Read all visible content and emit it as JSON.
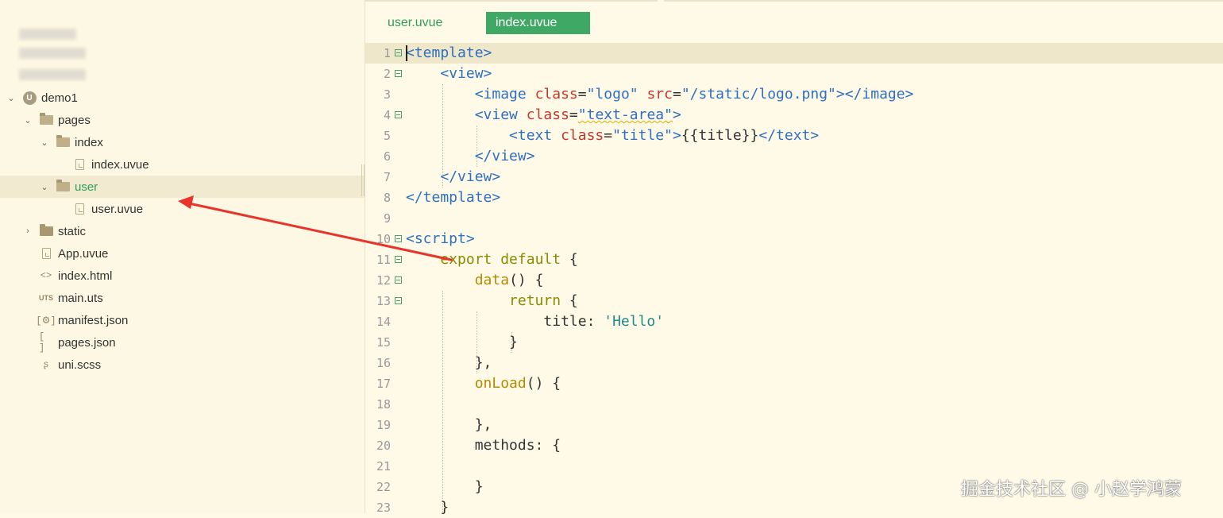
{
  "tabs": [
    {
      "label": "user.uvue",
      "active": false
    },
    {
      "label": "index.uvue",
      "active": true
    }
  ],
  "sidebar": {
    "tree": [
      {
        "label": "demo1",
        "icon": "uni-app-logo-icon",
        "expanded": true
      },
      {
        "label": "pages",
        "icon": "folder-open-icon",
        "expanded": true
      },
      {
        "label": "index",
        "icon": "folder-open-icon",
        "expanded": true
      },
      {
        "label": "index.uvue",
        "icon": "file-icon"
      },
      {
        "label": "user",
        "icon": "folder-open-icon",
        "expanded": true,
        "selected": true
      },
      {
        "label": "user.uvue",
        "icon": "file-icon"
      },
      {
        "label": "static",
        "icon": "folder-icon",
        "expanded": false
      },
      {
        "label": "App.uvue",
        "icon": "file-icon"
      },
      {
        "label": "index.html",
        "icon": "html-icon",
        "glyph": "<>"
      },
      {
        "label": "main.uts",
        "icon": "uts-icon",
        "glyph": "UTS"
      },
      {
        "label": "manifest.json",
        "icon": "gear-file-icon",
        "glyph": "[⚙]"
      },
      {
        "label": "pages.json",
        "icon": "json-icon",
        "glyph": "[ ]"
      },
      {
        "label": "uni.scss",
        "icon": "sass-icon",
        "glyph": "ʂ"
      }
    ]
  },
  "editor": {
    "lines": [
      {
        "n": "1",
        "fold": true,
        "tokens": [
          [
            "t-tag",
            "<template>"
          ]
        ]
      },
      {
        "n": "2",
        "fold": true,
        "tokens": [
          [
            "t-plain",
            "    "
          ],
          [
            "t-tag",
            "<view>"
          ]
        ]
      },
      {
        "n": "3",
        "fold": false,
        "tokens": [
          [
            "t-plain",
            "        "
          ],
          [
            "t-tag",
            "<image "
          ],
          [
            "t-attr",
            "class"
          ],
          [
            "t-plain",
            "="
          ],
          [
            "t-str",
            "\"logo\""
          ],
          [
            "t-plain",
            " "
          ],
          [
            "t-attr",
            "src"
          ],
          [
            "t-plain",
            "="
          ],
          [
            "t-str",
            "\"/static/logo.png\""
          ],
          [
            "t-tag",
            "></image>"
          ]
        ]
      },
      {
        "n": "4",
        "fold": true,
        "tokens": [
          [
            "t-plain",
            "        "
          ],
          [
            "t-tag",
            "<view "
          ],
          [
            "t-attr",
            "class"
          ],
          [
            "t-plain",
            "="
          ],
          [
            "t-str",
            "\"text-area\""
          ],
          [
            "t-tag",
            ">"
          ]
        ]
      },
      {
        "n": "5",
        "fold": false,
        "tokens": [
          [
            "t-plain",
            "            "
          ],
          [
            "t-tag",
            "<text "
          ],
          [
            "t-attr",
            "class"
          ],
          [
            "t-plain",
            "="
          ],
          [
            "t-str",
            "\"title\""
          ],
          [
            "t-tag",
            ">"
          ],
          [
            "t-plain",
            "{{title}}"
          ],
          [
            "t-tag",
            "</text>"
          ]
        ]
      },
      {
        "n": "6",
        "fold": false,
        "tokens": [
          [
            "t-plain",
            "        "
          ],
          [
            "t-tag",
            "</view>"
          ]
        ]
      },
      {
        "n": "7",
        "fold": false,
        "tokens": [
          [
            "t-plain",
            "    "
          ],
          [
            "t-tag",
            "</view>"
          ]
        ]
      },
      {
        "n": "8",
        "fold": false,
        "tokens": [
          [
            "t-tag",
            "</template>"
          ]
        ]
      },
      {
        "n": "9",
        "fold": false,
        "tokens": []
      },
      {
        "n": "10",
        "fold": true,
        "tokens": [
          [
            "t-tag",
            "<script>"
          ]
        ]
      },
      {
        "n": "11",
        "fold": true,
        "tokens": [
          [
            "t-plain",
            "    "
          ],
          [
            "t-kw",
            "export default"
          ],
          [
            "t-plain",
            " {"
          ]
        ]
      },
      {
        "n": "12",
        "fold": true,
        "tokens": [
          [
            "t-plain",
            "        "
          ],
          [
            "t-fn",
            "data"
          ],
          [
            "t-plain",
            "() {"
          ]
        ]
      },
      {
        "n": "13",
        "fold": true,
        "tokens": [
          [
            "t-plain",
            "            "
          ],
          [
            "t-kw",
            "return"
          ],
          [
            "t-plain",
            " {"
          ]
        ]
      },
      {
        "n": "14",
        "fold": false,
        "tokens": [
          [
            "t-plain",
            "                title: "
          ],
          [
            "t-sstr",
            "'Hello'"
          ]
        ]
      },
      {
        "n": "15",
        "fold": false,
        "tokens": [
          [
            "t-plain",
            "            }"
          ]
        ]
      },
      {
        "n": "16",
        "fold": false,
        "tokens": [
          [
            "t-plain",
            "        },"
          ]
        ]
      },
      {
        "n": "17",
        "fold": false,
        "tokens": [
          [
            "t-plain",
            "        "
          ],
          [
            "t-fn",
            "onLoad"
          ],
          [
            "t-plain",
            "() {"
          ]
        ]
      },
      {
        "n": "18",
        "fold": false,
        "tokens": []
      },
      {
        "n": "19",
        "fold": false,
        "tokens": [
          [
            "t-plain",
            "        },"
          ]
        ]
      },
      {
        "n": "20",
        "fold": false,
        "tokens": [
          [
            "t-plain",
            "        methods: {"
          ]
        ]
      },
      {
        "n": "21",
        "fold": false,
        "tokens": []
      },
      {
        "n": "22",
        "fold": false,
        "tokens": [
          [
            "t-plain",
            "        }"
          ]
        ]
      },
      {
        "n": "23",
        "fold": false,
        "tokens": [
          [
            "t-plain",
            "    }"
          ]
        ]
      }
    ],
    "current_line": "1"
  },
  "annotation": {
    "arrow_color": "#e8332a"
  },
  "watermark": "掘金技术社区 @ 小赵学鸿蒙"
}
